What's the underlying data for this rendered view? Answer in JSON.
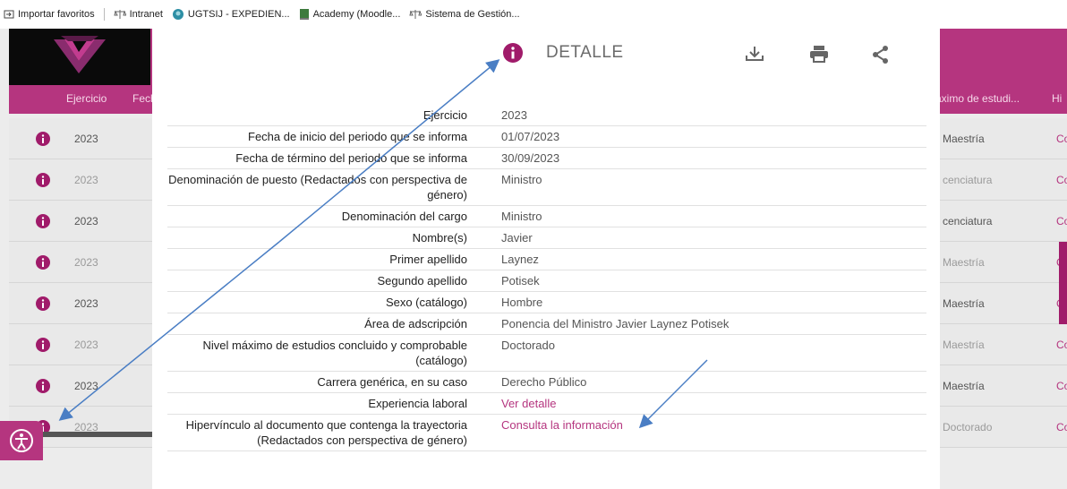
{
  "bookmarks": [
    {
      "label": "Importar favoritos",
      "icon": "import-icon"
    },
    {
      "label": "Intranet",
      "icon": "scale-icon"
    },
    {
      "label": "UGTSIJ - EXPEDIEN...",
      "icon": "ugtsij-icon"
    },
    {
      "label": "Academy (Moodle...",
      "icon": "academy-icon"
    },
    {
      "label": "Sistema de Gestión...",
      "icon": "scale-icon"
    }
  ],
  "background_table": {
    "headers": {
      "ejercicio": "Ejercicio",
      "fecha": "Fech",
      "nivel": "áximo de estudi...",
      "hipervinculo": "Hi"
    },
    "rows": [
      {
        "year": "2023",
        "nivel": "Maestría",
        "hv": "Co"
      },
      {
        "year": "2023",
        "nivel": "cenciatura",
        "hv": "Co"
      },
      {
        "year": "2023",
        "nivel": "cenciatura",
        "hv": "Co"
      },
      {
        "year": "2023",
        "nivel": "Maestría",
        "hv": "C"
      },
      {
        "year": "2023",
        "nivel": "Maestría",
        "hv": "C"
      },
      {
        "year": "2023",
        "nivel": "Maestría",
        "hv": "Co"
      },
      {
        "year": "2023",
        "nivel": "Maestría",
        "hv": "Co"
      },
      {
        "year": "2023",
        "nivel": "Doctorado",
        "hv": "Co"
      }
    ]
  },
  "modal": {
    "title": "DETALLE",
    "actions": {
      "download": "download-icon",
      "print": "print-icon",
      "share": "share-icon"
    },
    "rows": [
      {
        "label": "Ejercicio",
        "value": "2023"
      },
      {
        "label": "Fecha de inicio del periodo que se informa",
        "value": "01/07/2023"
      },
      {
        "label": "Fecha de término del periodo que se informa",
        "value": "30/09/2023"
      },
      {
        "label": "Denominación de puesto (Redactados con perspectiva de género)",
        "value": "Ministro"
      },
      {
        "label": "Denominación del cargo",
        "value": "Ministro"
      },
      {
        "label": "Nombre(s)",
        "value": "Javier"
      },
      {
        "label": "Primer apellido",
        "value": "Laynez"
      },
      {
        "label": "Segundo apellido",
        "value": "Potisek"
      },
      {
        "label": "Sexo (catálogo)",
        "value": "Hombre"
      },
      {
        "label": "Área de adscripción",
        "value": "Ponencia del Ministro Javier Laynez Potisek"
      },
      {
        "label": "Nivel máximo de estudios concluido y comprobable (catálogo)",
        "value": "Doctorado"
      },
      {
        "label": "Carrera genérica, en su caso",
        "value": "Derecho Público"
      },
      {
        "label": "Experiencia laboral",
        "value": "Ver detalle"
      },
      {
        "label": "Hipervínculo al documento que contenga la trayectoria (Redactados con perspectiva de género)",
        "value": "Consulta la información"
      }
    ]
  },
  "colors": {
    "brand": "#b5357f",
    "arrow": "#4a7ec4",
    "info_icon": "#a01b6a"
  }
}
